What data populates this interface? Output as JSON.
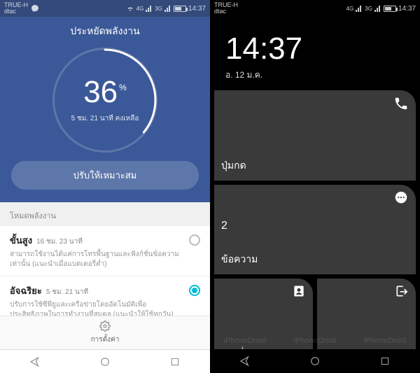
{
  "left": {
    "status": {
      "carrier1": "TRUE-H",
      "carrier2": "dtac",
      "net1": "4G",
      "net2": "3G",
      "time": "14:37"
    },
    "title": "ประหยัดพลังงาน",
    "battery_pct": "36",
    "pct_symbol": "%",
    "remaining": "5 ชม. 21 นาที คงเหลือ",
    "ring_pct": 36,
    "optimize": "ปรับให้เหมาะสม",
    "section": "โหมดพลังงาน",
    "modes": [
      {
        "name": "ขั้นสูง",
        "duration": "16 ชม. 23 นาที",
        "desc": "สามารถใช้งานได้แค่การโทรพื้นฐานและฟังก์ชั่นข้อความเท่านั้น (แนะนำเมื่อแบตเตอรี่ต่ำ)",
        "selected": false
      },
      {
        "name": "อัจฉริยะ",
        "duration": "5 ชม. 21 นาที",
        "desc": "ปรับการใช้ซีพียูและเครือข่ายโดยอัตโนมัติเพื่อประสิทธิภาพในการทำงานที่สมดุล (แนะนำให้ใช้ทุกวัน)",
        "selected": true
      }
    ],
    "settings": "การตั้งค่า"
  },
  "right": {
    "status": {
      "carrier1": "TRUE-H",
      "carrier2": "dtac",
      "net1": "4G",
      "net2": "3G",
      "time": "14:37"
    },
    "clock": "14:37",
    "date": "อ. 12 ม.ค.",
    "tiles": {
      "dialer": {
        "label": "ปุ่มกด"
      },
      "messages": {
        "count": "2",
        "label": "ข้อความ"
      },
      "contacts": {
        "label": "รายชื่อ"
      },
      "exit": {
        "label": "ออก"
      }
    }
  },
  "watermark": "iPhoneDroid"
}
